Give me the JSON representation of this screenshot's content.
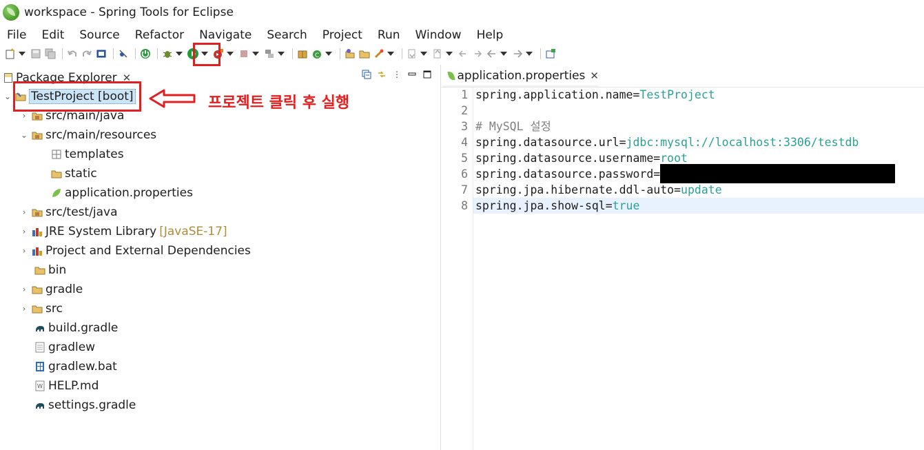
{
  "window": {
    "title": "workspace - Spring Tools for Eclipse"
  },
  "menu": [
    "File",
    "Edit",
    "Source",
    "Refactor",
    "Navigate",
    "Search",
    "Project",
    "Run",
    "Window",
    "Help"
  ],
  "package_explorer": {
    "title": "Package Explorer",
    "tree": [
      {
        "label": "TestProject [boot]",
        "icon": "project-icon",
        "expanded": true,
        "selected": true
      },
      {
        "label": "src/main/java",
        "icon": "source-folder-icon",
        "expanded": false
      },
      {
        "label": "src/main/resources",
        "icon": "source-folder-icon",
        "expanded": true
      },
      {
        "label": "templates",
        "icon": "package-icon"
      },
      {
        "label": "static",
        "icon": "folder-icon"
      },
      {
        "label": "application.properties",
        "icon": "spring-leaf-icon"
      },
      {
        "label": "src/test/java",
        "icon": "source-folder-icon",
        "expanded": false
      },
      {
        "label": "JRE System Library",
        "decoration": "[JavaSE-17]",
        "icon": "library-icon",
        "expanded": false
      },
      {
        "label": "Project and External Dependencies",
        "icon": "library-icon",
        "expanded": false
      },
      {
        "label": "bin",
        "icon": "folder-icon"
      },
      {
        "label": "gradle",
        "icon": "folder-icon",
        "expanded": false
      },
      {
        "label": "src",
        "icon": "folder-icon",
        "expanded": false
      },
      {
        "label": "build.gradle",
        "icon": "gradle-elephant-icon"
      },
      {
        "label": "gradlew",
        "icon": "text-file-icon"
      },
      {
        "label": "gradlew.bat",
        "icon": "bat-file-icon"
      },
      {
        "label": "HELP.md",
        "icon": "markdown-file-icon"
      },
      {
        "label": "settings.gradle",
        "icon": "gradle-elephant-icon"
      }
    ]
  },
  "annotation": {
    "text": "프로젝트 클릭 후 실행",
    "color": "#e02020"
  },
  "editor": {
    "tab_title": "application.properties",
    "lines": [
      {
        "num": "1",
        "key": "spring.application.name",
        "value": "TestProject"
      },
      {
        "num": "2"
      },
      {
        "num": "3",
        "comment": "# MySQL 설정"
      },
      {
        "num": "4",
        "key": "spring.datasource.url",
        "value": "jdbc:mysql://localhost:3306/testdb"
      },
      {
        "num": "5",
        "key": "spring.datasource.username",
        "value": "root"
      },
      {
        "num": "6",
        "key": "spring.datasource.password",
        "value": "",
        "redacted": true
      },
      {
        "num": "7",
        "key": "spring.jpa.hibernate.ddl-auto",
        "value": "update"
      },
      {
        "num": "8",
        "key": "spring.jpa.show-sql",
        "value": "true",
        "current": true
      }
    ]
  },
  "colors": {
    "value_color": "#2aa198",
    "comment_color": "#808080",
    "current_line": "#e8f2fe",
    "highlight_red": "#e02020"
  }
}
